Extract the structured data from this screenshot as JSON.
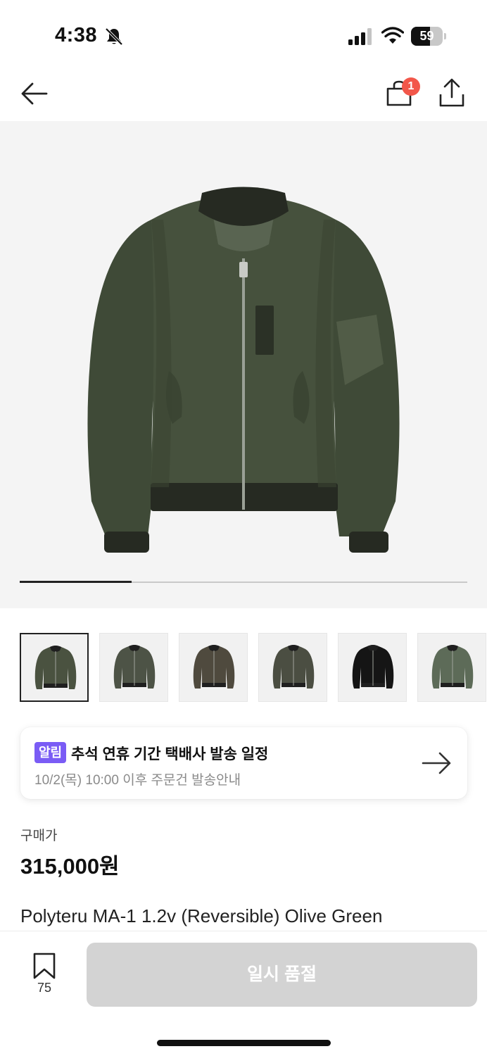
{
  "status_bar": {
    "time": "4:38",
    "battery": "59",
    "battery_level": 0.59,
    "icons": [
      "bell-slash-icon",
      "cellular-signal-icon",
      "wifi-icon",
      "battery-icon"
    ]
  },
  "nav": {
    "icons": [
      "arrow-left-icon",
      "shopping-bag-icon",
      "share-icon"
    ],
    "cart_count": "1"
  },
  "gallery": {
    "current_index": 1,
    "total_images": 6,
    "progress_fraction": 0.25,
    "thumbnails": [
      {
        "color": "#4a5240",
        "selected": true
      },
      {
        "color": "#4d5346",
        "selected": false
      },
      {
        "color": "#4f4a3e",
        "selected": false
      },
      {
        "color": "#4b4e42",
        "selected": false
      },
      {
        "color": "#151515",
        "selected": false
      },
      {
        "color": "#5d6b58",
        "selected": false
      }
    ]
  },
  "notice": {
    "badge": "알림",
    "title": "추석 연휴 기간 택배사 발송 일정",
    "subtitle": "10/2(목) 10:00 이후 주문건 발송안내",
    "accent_color": "#7a5cf5"
  },
  "price": {
    "label": "구매가",
    "value": "315,000원"
  },
  "product": {
    "name": "Polyteru MA-1 1.2v (Reversible) Olive Green"
  },
  "bottom_bar": {
    "wishlist_count": "75",
    "button_label": "일시 품절"
  }
}
